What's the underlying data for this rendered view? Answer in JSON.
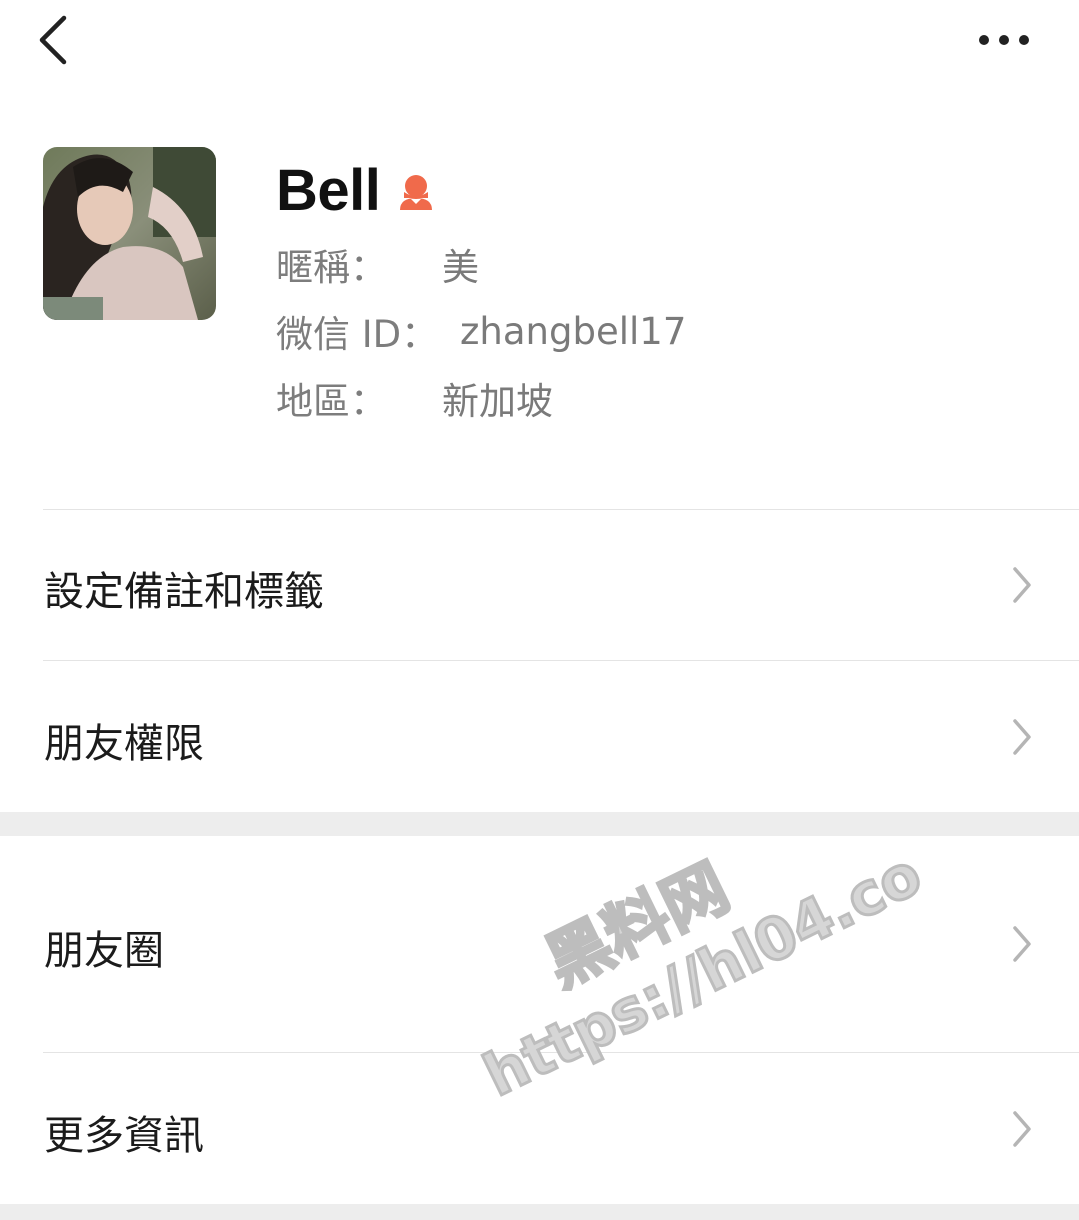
{
  "profile": {
    "name": "Bell",
    "nickname_label": "暱稱：",
    "nickname_value": "美",
    "wechat_id_label": "微信 ID：",
    "wechat_id_value": "zhangbell17",
    "region_label": "地區：",
    "region_value": "新加坡",
    "gender_icon": "female-icon"
  },
  "menu": {
    "set_remark_label": "設定備註和標籤",
    "friend_permissions_label": "朋友權限",
    "moments_label": "朋友圈",
    "more_info_label": "更多資訊"
  },
  "watermark": {
    "line1": "黑料网",
    "line2": "https://hl04.co"
  },
  "colors": {
    "accent_female": "#f06a4b",
    "label_gray": "#7d7d7d",
    "separator": "#ededed"
  }
}
